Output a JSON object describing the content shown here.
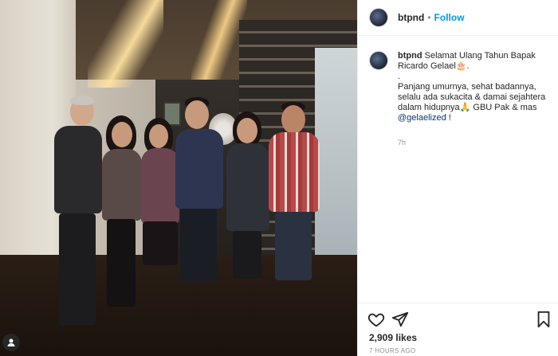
{
  "post": {
    "username": "btpnd",
    "separator": "•",
    "follow_label": "Follow",
    "caption_lines": [
      "Selamat Ulang Tahun Bapak Ricardo Gelael🎂.",
      ".",
      "Panjang umurnya, sehat badannya, selalu ada sukacita & damai sejahtera dalam hidupnya🙏 GBU Pak & mas"
    ],
    "mention": "@gelaelized",
    "mention_suffix": " !",
    "comment_time": "7h",
    "likes": "2,909 likes",
    "posted_ago": "7 HOURS AGO"
  },
  "icons": {
    "like": "heart-icon",
    "share": "paper-plane-icon",
    "save": "bookmark-icon",
    "user": "user-icon"
  },
  "colors": {
    "follow": "#0095f6",
    "mention": "#00376b",
    "muted": "#8e8e8e"
  }
}
